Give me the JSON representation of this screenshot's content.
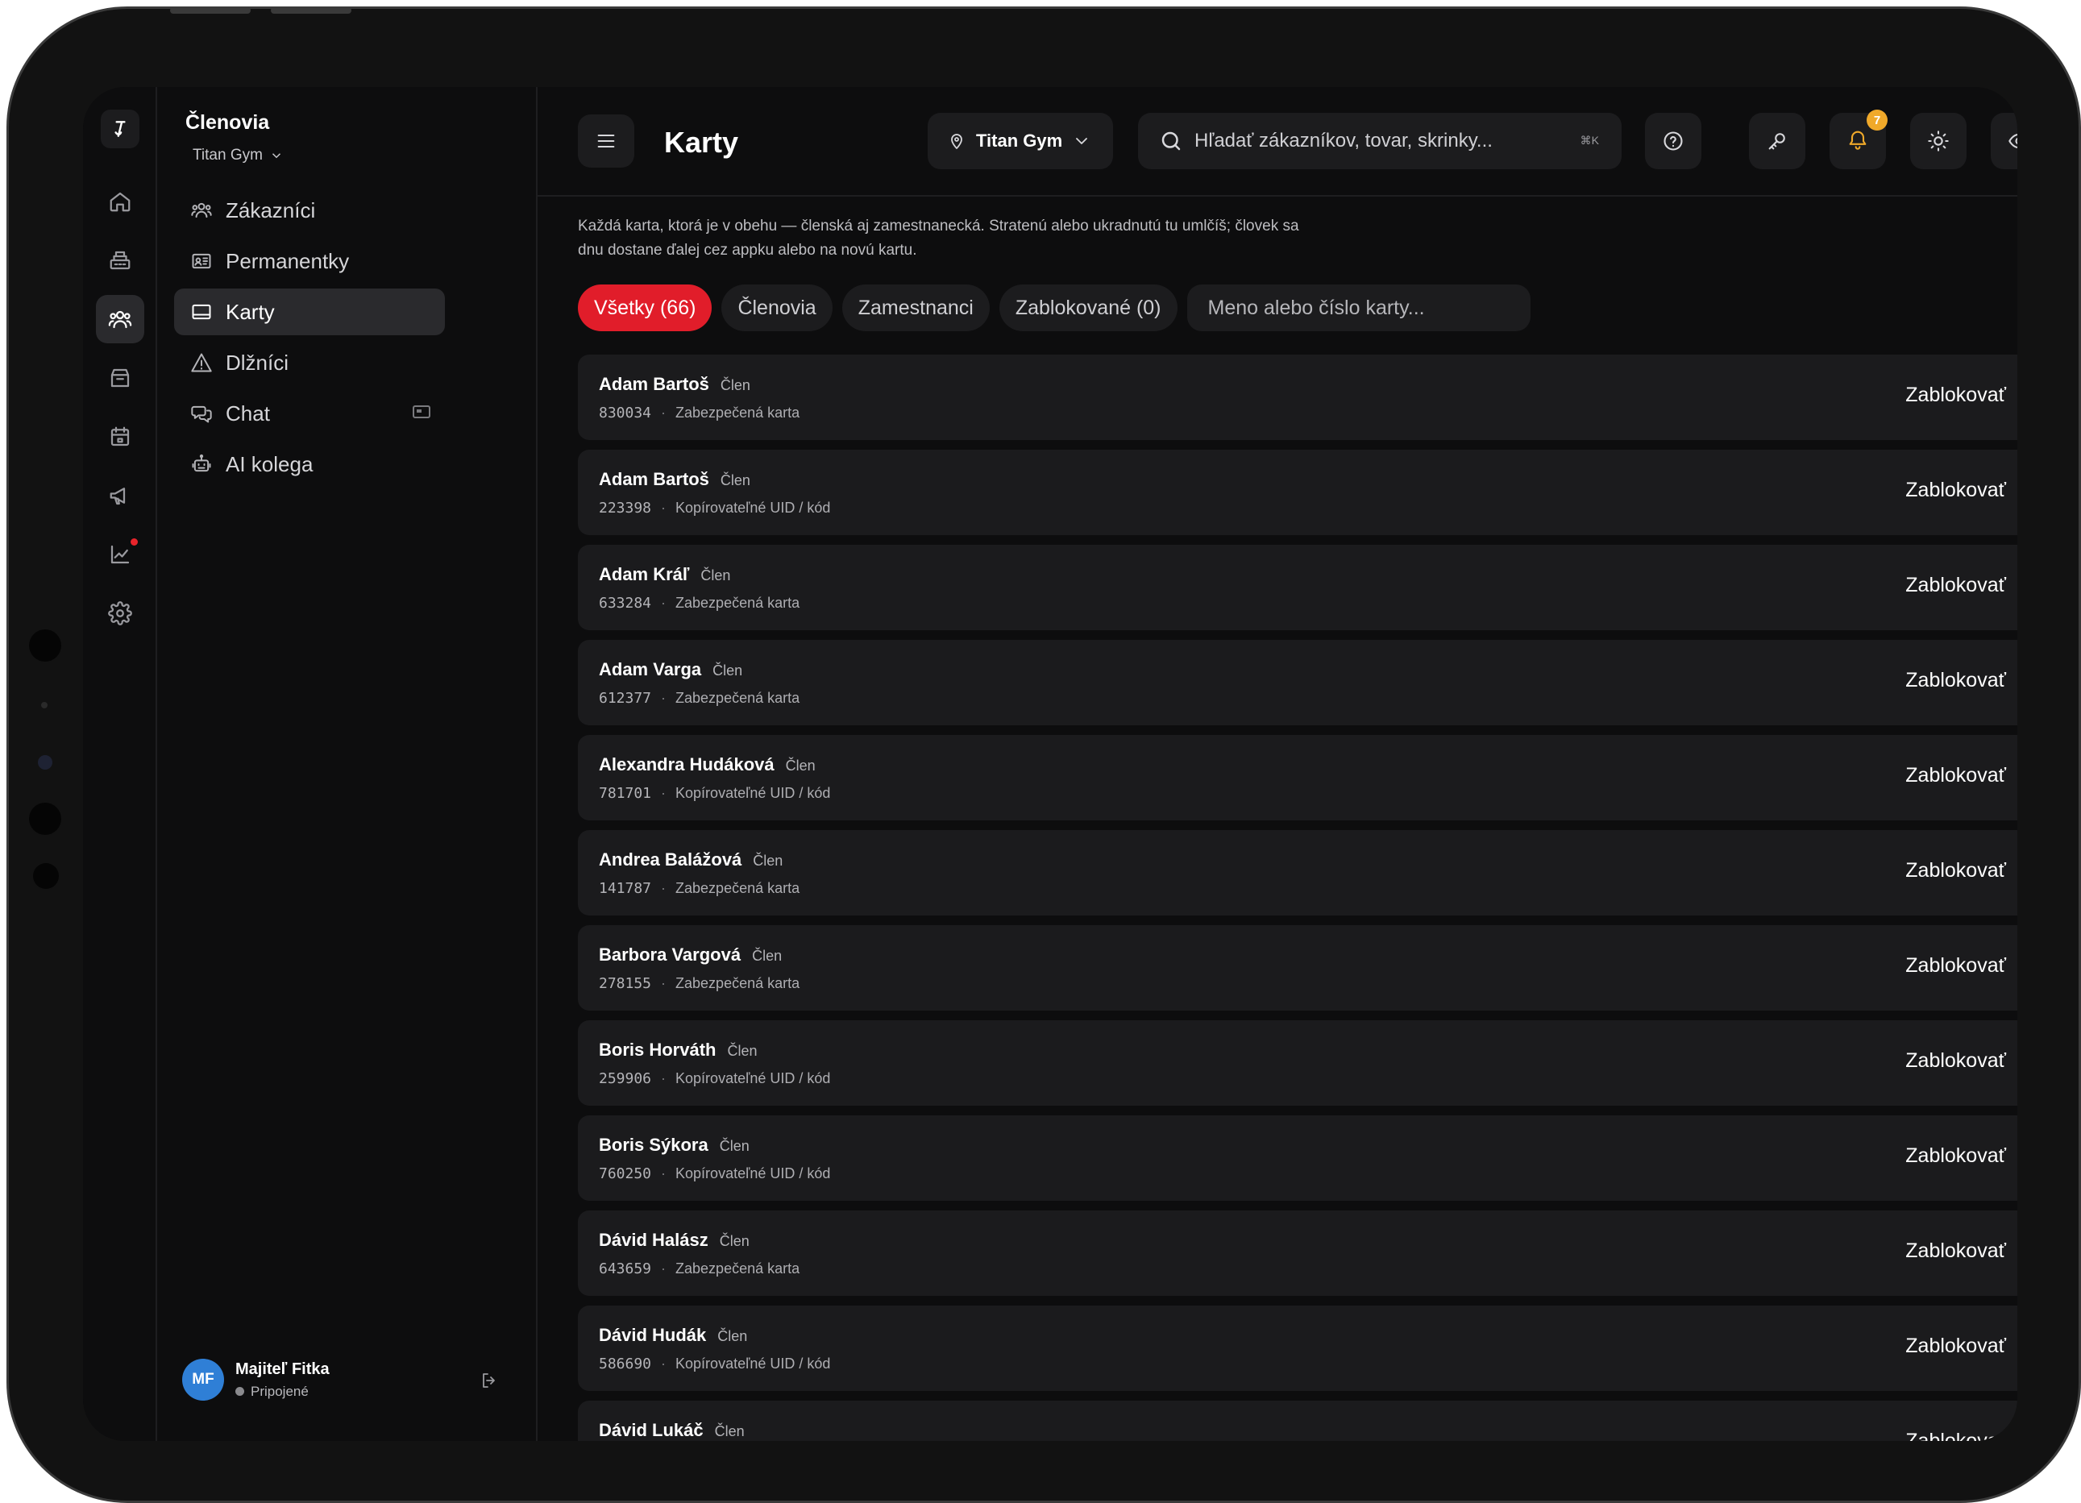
{
  "rail": {
    "items": [
      {
        "name": "home-icon"
      },
      {
        "name": "cash-register-icon"
      },
      {
        "name": "members-icon",
        "active": true
      },
      {
        "name": "shop-icon"
      },
      {
        "name": "calendar-icon"
      },
      {
        "name": "megaphone-icon"
      },
      {
        "name": "analytics-icon",
        "has_alert": true
      },
      {
        "name": "settings-icon"
      }
    ]
  },
  "sidebar": {
    "title": "Členovia",
    "gym": "Titan Gym",
    "items": [
      {
        "label": "Zákazníci",
        "icon": "users-icon"
      },
      {
        "label": "Permanentky",
        "icon": "pass-icon"
      },
      {
        "label": "Karty",
        "icon": "card-icon",
        "active": true
      },
      {
        "label": "Dlžníci",
        "icon": "warning-icon"
      },
      {
        "label": "Chat",
        "icon": "chat-icon"
      },
      {
        "label": "AI kolega",
        "icon": "robot-icon"
      }
    ],
    "user": {
      "initials": "MF",
      "name": "Majiteľ Fitka",
      "status": "Pripojené"
    }
  },
  "header": {
    "title": "Karty",
    "gym_select": "Titan Gym",
    "search_placeholder": "Hľadať zákazníkov, tovar, skrinky...",
    "search_shortcut": "⌘K",
    "notifications_count": "7",
    "accent_color": "#e11d2a",
    "bell_color": "#f0a92a"
  },
  "main": {
    "description_line1": "Každá karta, ktorá je v obehu — členská aj zamestnanecká. Stratenú alebo ukradnutú tu umlčíš; človek sa",
    "description_line2": "dnu dostane ďalej cez appku alebo na novú kartu.",
    "filters": [
      {
        "label": "Všetky (66)",
        "active": true
      },
      {
        "label": "Členovia"
      },
      {
        "label": "Zamestnanci"
      },
      {
        "label": "Zablokované (0)"
      }
    ],
    "card_search_placeholder": "Meno alebo číslo karty...",
    "action_label": "Zablokovať",
    "cards": [
      {
        "name": "Adam Bartoš",
        "role": "Člen",
        "number": "830034",
        "type": "Zabezpečená karta"
      },
      {
        "name": "Adam Bartoš",
        "role": "Člen",
        "number": "223398",
        "type": "Kopírovateľné UID / kód"
      },
      {
        "name": "Adam Kráľ",
        "role": "Člen",
        "number": "633284",
        "type": "Zabezpečená karta"
      },
      {
        "name": "Adam Varga",
        "role": "Člen",
        "number": "612377",
        "type": "Zabezpečená karta"
      },
      {
        "name": "Alexandra Hudáková",
        "role": "Člen",
        "number": "781701",
        "type": "Kopírovateľné UID / kód"
      },
      {
        "name": "Andrea Balážová",
        "role": "Člen",
        "number": "141787",
        "type": "Zabezpečená karta"
      },
      {
        "name": "Barbora Vargová",
        "role": "Člen",
        "number": "278155",
        "type": "Zabezpečená karta"
      },
      {
        "name": "Boris Horváth",
        "role": "Člen",
        "number": "259906",
        "type": "Kopírovateľné UID / kód"
      },
      {
        "name": "Boris Sýkora",
        "role": "Člen",
        "number": "760250",
        "type": "Kopírovateľné UID / kód"
      },
      {
        "name": "Dávid Halász",
        "role": "Člen",
        "number": "643659",
        "type": "Zabezpečená karta"
      },
      {
        "name": "Dávid Hudák",
        "role": "Člen",
        "number": "586690",
        "type": "Kopírovateľné UID / kód"
      },
      {
        "name": "Dávid Lukáč",
        "role": "Člen",
        "number": "",
        "type": ""
      }
    ]
  }
}
